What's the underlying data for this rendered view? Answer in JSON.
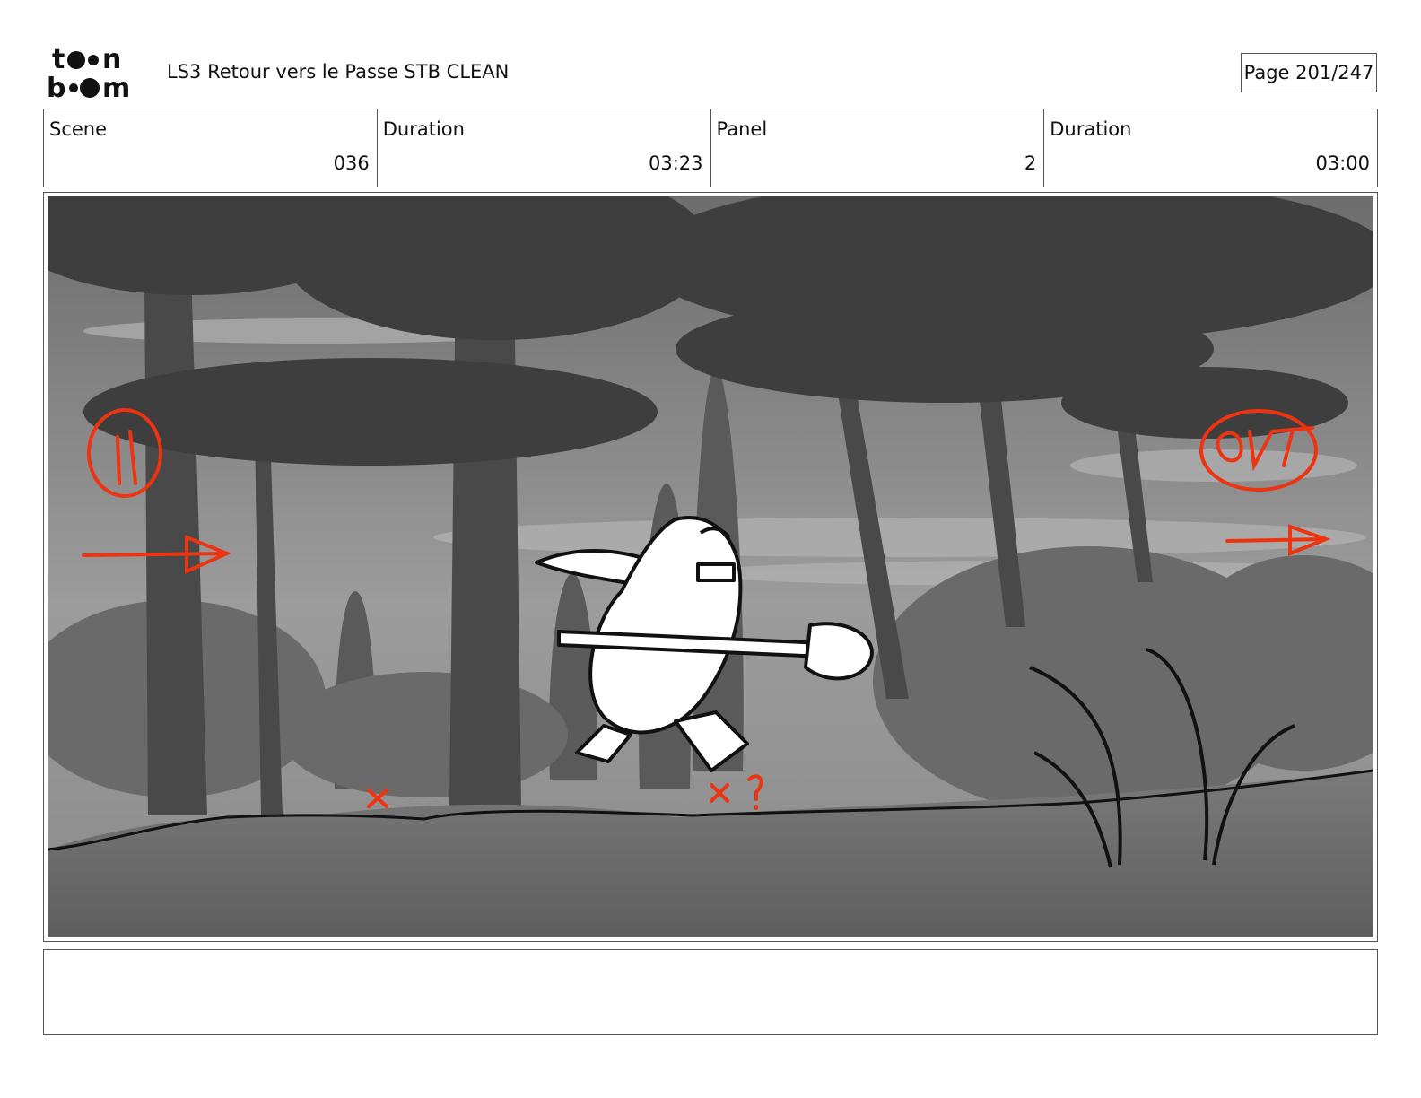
{
  "header": {
    "logo_text": "toon boom",
    "title": "LS3 Retour vers le Passe STB CLEAN",
    "page": "Page 201/247"
  },
  "info": {
    "scene_label": "Scene",
    "scene_value": "036",
    "duration_label": "Duration",
    "duration_value": "03:23",
    "panel_label": "Panel",
    "panel_value": "2",
    "panel_duration_label": "Duration",
    "panel_duration_value": "03:00"
  },
  "panel": {
    "annotations": {
      "in_label": "IN",
      "out_label": "OUT"
    },
    "annotation_color": "#ee3311"
  },
  "notes": {
    "text": ""
  }
}
